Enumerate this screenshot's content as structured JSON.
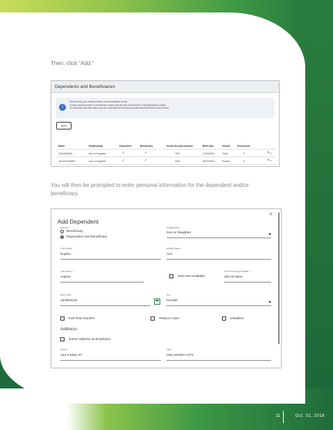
{
  "page": {
    "instruction_1": "Then, click “Add.”",
    "instruction_2": "You will then be prompted to enter personal information for the dependent and/or beneficiary.",
    "page_number": "11",
    "date": "Oct. 31, 2018"
  },
  "dependents_panel": {
    "title": "Dependents and Beneficiaries",
    "info_lines": [
      "Please verify your family members and beneficiaries on file.",
      "To add a family member or beneficiary, simply click the Add 'Dependent' or 'Add Beneficiary' button.",
      "You may also add them later once you have learned more about a particular benefit plan and enrolled."
    ],
    "add_label": "ADD",
    "columns": [
      "Name",
      "Relationship",
      "Dependent",
      "Beneficiary",
      "Social Security Number",
      "Birth Date",
      "Gender",
      "Documents"
    ],
    "rows": [
      {
        "name": "LIAN ADAMS",
        "relationship": "Son or Daughter",
        "dependent": "✓",
        "beneficiary": "✓",
        "ssn": "7970",
        "birth_date": "12/20/2001",
        "gender": "Male",
        "documents": "0"
      },
      {
        "name": "JULIAN ADAMS",
        "relationship": "Son or Daughter",
        "dependent": "✓",
        "beneficiary": "✓",
        "ssn": "0000",
        "birth_date": "08/27/2004",
        "gender": "Female",
        "documents": "0"
      }
    ]
  },
  "add_dependent": {
    "title": "Add Dependent",
    "close": "×",
    "add_as_label": "Add As *",
    "option_beneficiary": "Beneficiary",
    "option_both": "Dependent And Beneficiary",
    "relationship_label": "Relationship",
    "relationship_value": "Son or Daughter",
    "first_name_label": "First Name *",
    "first_name_value": "Sophie",
    "middle_name_label": "Middle Name",
    "middle_name_value": "Ann",
    "last_name_label": "Last Name *",
    "last_name_value": "Adams",
    "ssn_na_label": "SSN Not Available",
    "ssn_label": "Social Security Number *",
    "ssn_value": "100 00 0001",
    "birth_date_label": "Birth Date *",
    "birth_date_value": "10/28/2018",
    "sex_label": "Sex",
    "sex_value": "Female",
    "full_time_student": "Full-Time Student",
    "tobacco_user": "Tobacco User",
    "disabled": "Disabled",
    "address_heading": "Address",
    "same_address": "Same Address as Employee",
    "street_label": "Street *",
    "street_value": "123 S Main ST",
    "city_label": "City *",
    "city_value": "OKLAHOMA CITY"
  }
}
